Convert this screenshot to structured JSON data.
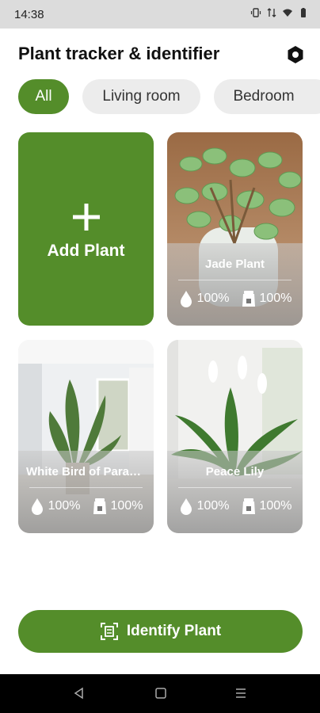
{
  "status_bar": {
    "time": "14:38"
  },
  "header": {
    "title": "Plant tracker & identifier"
  },
  "filters": [
    {
      "label": "All",
      "active": true
    },
    {
      "label": "Living room",
      "active": false
    },
    {
      "label": "Bedroom",
      "active": false
    }
  ],
  "add_card": {
    "label": "Add Plant"
  },
  "plants": [
    {
      "name": "Jade Plant",
      "water": "100%",
      "soil": "100%"
    },
    {
      "name": "White Bird of Paradise",
      "water": "100%",
      "soil": "100%"
    },
    {
      "name": "Peace Lily",
      "water": "100%",
      "soil": "100%"
    }
  ],
  "identify_button": {
    "label": "Identify Plant"
  },
  "colors": {
    "accent": "#548d2a",
    "chip_bg": "#ececec",
    "status_bar": "#dcdcdc"
  }
}
